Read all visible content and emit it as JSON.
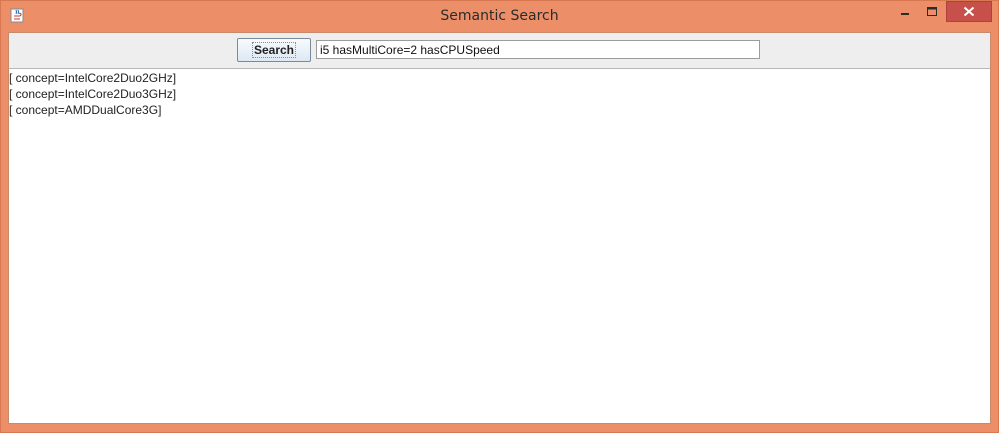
{
  "window": {
    "title": "Semantic Search",
    "title_icon": "java-cup-icon",
    "frame_color": "#ec8e68",
    "close_button_color": "#c7504a"
  },
  "toolbar": {
    "search_label": "Search",
    "query_value": "i5 hasMultiCore=2 hasCPUSpeed"
  },
  "results": [
    "[ concept=IntelCore2Duo2GHz]",
    "[ concept=IntelCore2Duo3GHz]",
    "[ concept=AMDDualCore3G]"
  ]
}
